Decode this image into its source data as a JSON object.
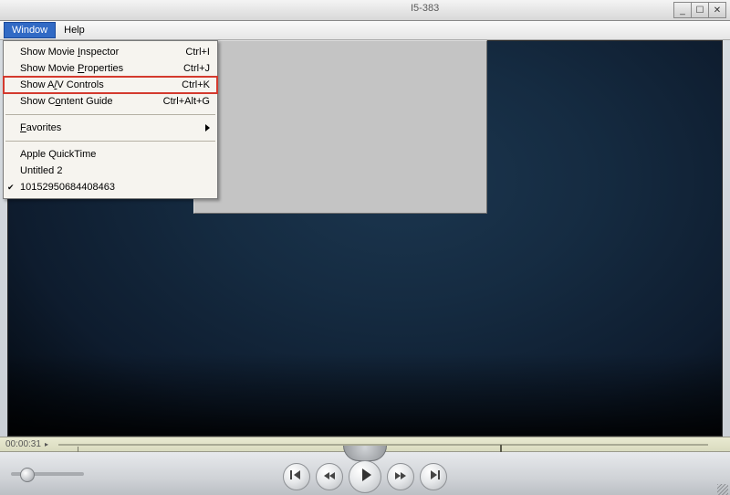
{
  "titlebar": {
    "text": "I5-383"
  },
  "window_buttons": {
    "min": "_",
    "max": "☐",
    "close": "✕"
  },
  "menubar": {
    "window": "Window",
    "help": "Help"
  },
  "dropdown": {
    "show_inspector": {
      "label_pre": "Show Movie ",
      "label_u": "I",
      "label_post": "nspector",
      "shortcut": "Ctrl+I"
    },
    "show_properties": {
      "label_pre": "Show Movie  ",
      "label_u": "P",
      "label_post": "roperties",
      "shortcut": "Ctrl+J"
    },
    "show_av": {
      "label_pre": "Show A",
      "label_u": "/",
      "label_post": "V Controls",
      "shortcut": "Ctrl+K"
    },
    "show_guide": {
      "label_pre": "Show C",
      "label_u": "o",
      "label_post": "ntent Guide",
      "shortcut": "Ctrl+Alt+G"
    },
    "favorites": {
      "label_u": "F",
      "label_post": "avorites"
    },
    "recent1": "Apple QuickTime",
    "recent2": "Untitled 2",
    "recent3": "10152950684408463",
    "check": "✔"
  },
  "playback": {
    "time": "00:00:31",
    "time_separator": "▸"
  }
}
